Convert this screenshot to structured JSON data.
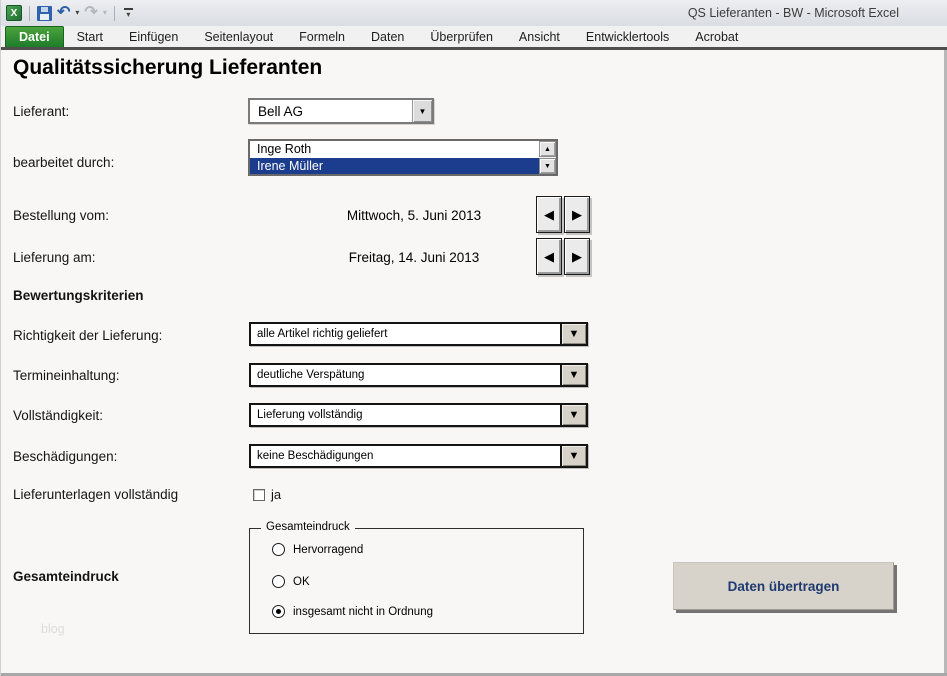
{
  "window": {
    "title": "QS Lieferanten - BW - Microsoft Excel",
    "tabs": [
      {
        "label": "Datei",
        "active": true
      },
      {
        "label": "Start",
        "active": false
      },
      {
        "label": "Einfügen",
        "active": false
      },
      {
        "label": "Seitenlayout",
        "active": false
      },
      {
        "label": "Formeln",
        "active": false
      },
      {
        "label": "Daten",
        "active": false
      },
      {
        "label": "Überprüfen",
        "active": false
      },
      {
        "label": "Ansicht",
        "active": false
      },
      {
        "label": "Entwicklertools",
        "active": false
      },
      {
        "label": "Acrobat",
        "active": false
      }
    ]
  },
  "icons": {
    "excel_letter": "X",
    "undo_glyph": "↶",
    "redo_glyph": "↷",
    "caret_down": "▾",
    "arrow_down": "▼",
    "arrow_up": "▲",
    "arrow_left": "◀",
    "arrow_right": "▶"
  },
  "colors": {
    "active_tab_green": "#1e7c2a",
    "list_selection_blue": "#1c3c8d",
    "button_text_navy": "#1e3a70"
  },
  "form": {
    "title": "Qualitätssicherung Lieferanten",
    "supplier": {
      "label": "Lieferant:",
      "value": "Bell AG"
    },
    "editor": {
      "label": "bearbeitet durch:",
      "options": [
        {
          "text": "Inge Roth",
          "selected": false
        },
        {
          "text": "Irene Müller",
          "selected": true
        }
      ]
    },
    "order_date": {
      "label": "Bestellung vom:",
      "value": "Mittwoch, 5. Juni 2013"
    },
    "delivery_date": {
      "label": "Lieferung am:",
      "value": "Freitag, 14. Juni 2013"
    },
    "criteria_heading": "Bewertungskriterien",
    "criteria": [
      {
        "label": "Richtigkeit der Lieferung:",
        "value": "alle Artikel richtig geliefert"
      },
      {
        "label": "Termineinhaltung:",
        "value": "deutliche Verspätung"
      },
      {
        "label": "Vollständigkeit:",
        "value": "Lieferung vollständig"
      },
      {
        "label": "Beschädigungen:",
        "value": "keine Beschädigungen"
      }
    ],
    "documents": {
      "label": "Lieferunterlagen vollständig",
      "checkbox_label": "ja",
      "checked": false
    },
    "overall": {
      "label": "Gesamteindruck",
      "group_title": "Gesamteindruck",
      "options": [
        {
          "text": "Hervorragend",
          "selected": false
        },
        {
          "text": "OK",
          "selected": false
        },
        {
          "text": "insgesamt nicht in Ordnung",
          "selected": true
        }
      ]
    },
    "submit_label": "Daten übertragen",
    "watermark": "blog"
  }
}
